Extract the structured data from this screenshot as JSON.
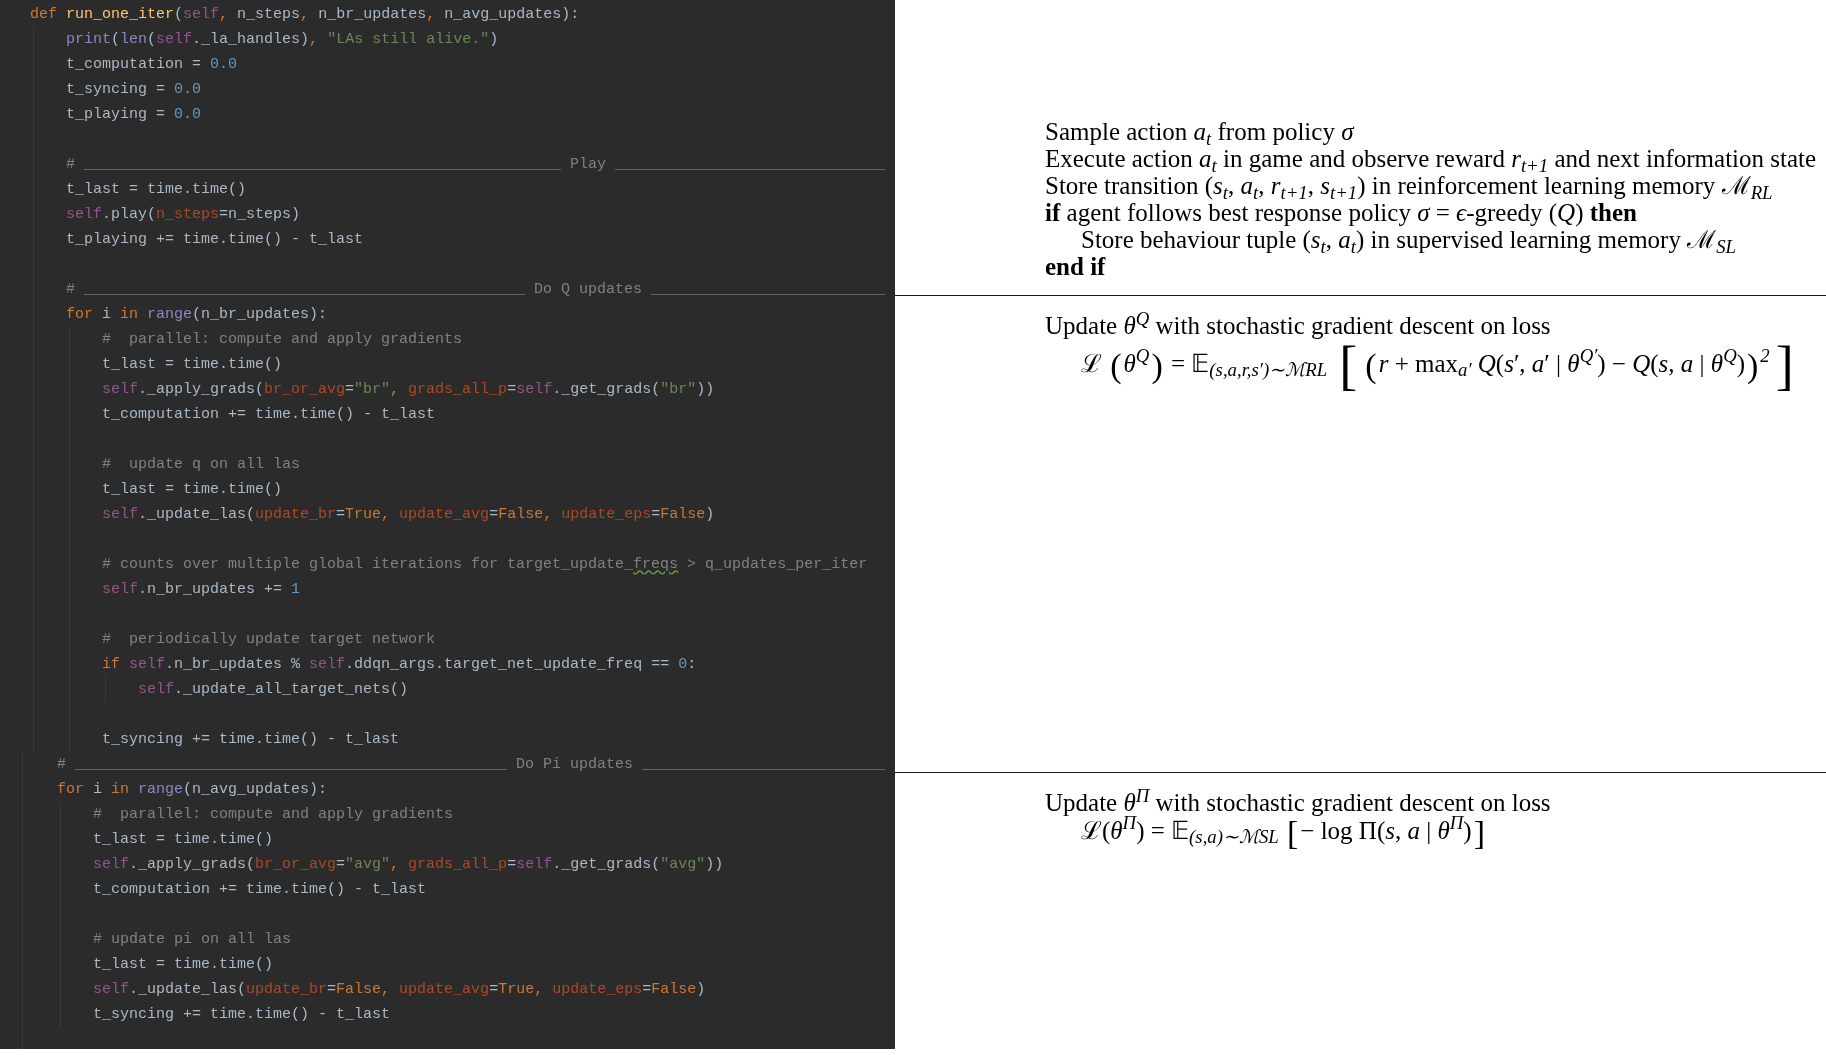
{
  "code_editor": {
    "snippets": [
      {
        "lines": [
          {
            "kind": "code",
            "tokens": [
              {
                "kind": "kw",
                "text": "def "
              },
              {
                "kind": "fn",
                "text": "run_one_iter"
              },
              {
                "kind": "txt",
                "text": "("
              },
              {
                "kind": "self",
                "text": "self"
              },
              {
                "kind": "pun",
                "text": ", "
              },
              {
                "kind": "txt",
                "text": "n_steps"
              },
              {
                "kind": "pun",
                "text": ", "
              },
              {
                "kind": "txt",
                "text": "n_br_updates"
              },
              {
                "kind": "pun",
                "text": ", "
              },
              {
                "kind": "txt",
                "text": "n_avg_updates):"
              }
            ],
            "children": [
              {
                "kind": "code",
                "tokens": [
                  {
                    "kind": "bi",
                    "text": "print"
                  },
                  {
                    "kind": "txt",
                    "text": "("
                  },
                  {
                    "kind": "bi",
                    "text": "len"
                  },
                  {
                    "kind": "txt",
                    "text": "("
                  },
                  {
                    "kind": "self",
                    "text": "self"
                  },
                  {
                    "kind": "txt",
                    "text": "._la_handles)"
                  },
                  {
                    "kind": "pun",
                    "text": ", "
                  },
                  {
                    "kind": "str",
                    "text": "\"LAs still alive.\""
                  },
                  {
                    "kind": "txt",
                    "text": ")"
                  }
                ]
              },
              {
                "kind": "code",
                "tokens": [
                  {
                    "kind": "txt",
                    "text": "t_computation = "
                  },
                  {
                    "kind": "num",
                    "text": "0.0"
                  }
                ]
              },
              {
                "kind": "code",
                "tokens": [
                  {
                    "kind": "txt",
                    "text": "t_syncing = "
                  },
                  {
                    "kind": "num",
                    "text": "0.0"
                  }
                ]
              },
              {
                "kind": "code",
                "tokens": [
                  {
                    "kind": "txt",
                    "text": "t_playing = "
                  },
                  {
                    "kind": "num",
                    "text": "0.0"
                  }
                ]
              },
              {
                "kind": "blank"
              },
              {
                "kind": "code",
                "tokens": [
                  {
                    "kind": "cmt",
                    "text": "# _____________________________________________________ Play ______________________________"
                  }
                ]
              },
              {
                "kind": "code",
                "tokens": [
                  {
                    "kind": "txt",
                    "text": "t_last = time.time()"
                  }
                ]
              },
              {
                "kind": "code",
                "tokens": [
                  {
                    "kind": "self",
                    "text": "self"
                  },
                  {
                    "kind": "txt",
                    "text": ".play("
                  },
                  {
                    "kind": "arg",
                    "text": "n_steps"
                  },
                  {
                    "kind": "txt",
                    "text": "=n_steps)"
                  }
                ]
              },
              {
                "kind": "code",
                "tokens": [
                  {
                    "kind": "txt",
                    "text": "t_playing += time.time() - t_last"
                  }
                ]
              },
              {
                "kind": "blank"
              },
              {
                "kind": "code",
                "tokens": [
                  {
                    "kind": "cmt",
                    "text": "# _________________________________________________ Do Q updates __________________________"
                  }
                ]
              },
              {
                "kind": "code",
                "tokens": [
                  {
                    "kind": "kw",
                    "text": "for "
                  },
                  {
                    "kind": "txt",
                    "text": "i "
                  },
                  {
                    "kind": "kw",
                    "text": "in "
                  },
                  {
                    "kind": "bi",
                    "text": "range"
                  },
                  {
                    "kind": "txt",
                    "text": "(n_br_updates):"
                  }
                ],
                "children": [
                  {
                    "kind": "code",
                    "tokens": [
                      {
                        "kind": "cmt",
                        "text": "#  parallel: compute and apply gradients"
                      }
                    ]
                  },
                  {
                    "kind": "code",
                    "tokens": [
                      {
                        "kind": "txt",
                        "text": "t_last = time.time()"
                      }
                    ]
                  },
                  {
                    "kind": "code",
                    "tokens": [
                      {
                        "kind": "self",
                        "text": "self"
                      },
                      {
                        "kind": "txt",
                        "text": "._apply_grads("
                      },
                      {
                        "kind": "arg",
                        "text": "br_or_avg"
                      },
                      {
                        "kind": "txt",
                        "text": "="
                      },
                      {
                        "kind": "str",
                        "text": "\"br\""
                      },
                      {
                        "kind": "pun",
                        "text": ", "
                      },
                      {
                        "kind": "arg",
                        "text": "grads_all_p"
                      },
                      {
                        "kind": "txt",
                        "text": "="
                      },
                      {
                        "kind": "self",
                        "text": "self"
                      },
                      {
                        "kind": "txt",
                        "text": "._get_grads("
                      },
                      {
                        "kind": "str",
                        "text": "\"br\""
                      },
                      {
                        "kind": "txt",
                        "text": "))"
                      }
                    ]
                  },
                  {
                    "kind": "code",
                    "tokens": [
                      {
                        "kind": "txt",
                        "text": "t_computation += time.time() - t_last"
                      }
                    ]
                  },
                  {
                    "kind": "blank"
                  },
                  {
                    "kind": "code",
                    "tokens": [
                      {
                        "kind": "cmt",
                        "text": "#  update q on all las"
                      }
                    ]
                  },
                  {
                    "kind": "code",
                    "tokens": [
                      {
                        "kind": "txt",
                        "text": "t_last = time.time()"
                      }
                    ]
                  },
                  {
                    "kind": "code",
                    "tokens": [
                      {
                        "kind": "self",
                        "text": "self"
                      },
                      {
                        "kind": "txt",
                        "text": "._update_las("
                      },
                      {
                        "kind": "arg",
                        "text": "update_br"
                      },
                      {
                        "kind": "txt",
                        "text": "="
                      },
                      {
                        "kind": "kw",
                        "text": "True"
                      },
                      {
                        "kind": "pun",
                        "text": ", "
                      },
                      {
                        "kind": "arg",
                        "text": "update_avg"
                      },
                      {
                        "kind": "txt",
                        "text": "="
                      },
                      {
                        "kind": "kw",
                        "text": "False"
                      },
                      {
                        "kind": "pun",
                        "text": ", "
                      },
                      {
                        "kind": "arg",
                        "text": "update_eps"
                      },
                      {
                        "kind": "txt",
                        "text": "="
                      },
                      {
                        "kind": "kw",
                        "text": "False"
                      },
                      {
                        "kind": "txt",
                        "text": ")"
                      }
                    ]
                  },
                  {
                    "kind": "blank"
                  },
                  {
                    "kind": "code",
                    "tokens": [
                      {
                        "kind": "cmt",
                        "text": "# counts over multiple global iterations for target_update_"
                      },
                      {
                        "kind": "typo",
                        "text": "freqs"
                      },
                      {
                        "kind": "cmt",
                        "text": " > q_updates_per_iter"
                      }
                    ]
                  },
                  {
                    "kind": "code",
                    "tokens": [
                      {
                        "kind": "self",
                        "text": "self"
                      },
                      {
                        "kind": "txt",
                        "text": ".n_br_updates += "
                      },
                      {
                        "kind": "num",
                        "text": "1"
                      }
                    ]
                  },
                  {
                    "kind": "blank"
                  },
                  {
                    "kind": "code",
                    "tokens": [
                      {
                        "kind": "cmt",
                        "text": "#  periodically update target network"
                      }
                    ]
                  },
                  {
                    "kind": "code",
                    "tokens": [
                      {
                        "kind": "kw",
                        "text": "if "
                      },
                      {
                        "kind": "self",
                        "text": "self"
                      },
                      {
                        "kind": "txt",
                        "text": ".n_br_updates % "
                      },
                      {
                        "kind": "self",
                        "text": "self"
                      },
                      {
                        "kind": "txt",
                        "text": ".ddqn_args.target_net_update_freq == "
                      },
                      {
                        "kind": "num",
                        "text": "0"
                      },
                      {
                        "kind": "txt",
                        "text": ":"
                      }
                    ],
                    "children": [
                      {
                        "kind": "code",
                        "tokens": [
                          {
                            "kind": "self",
                            "text": "self"
                          },
                          {
                            "kind": "txt",
                            "text": "._update_all_target_nets()"
                          }
                        ]
                      }
                    ]
                  },
                  {
                    "kind": "blank"
                  },
                  {
                    "kind": "code",
                    "tokens": [
                      {
                        "kind": "txt",
                        "text": "t_syncing += time.time() - t_last"
                      }
                    ]
                  }
                ]
              }
            ]
          }
        ]
      },
      {
        "lines": [
          {
            "kind": "code",
            "tokens": [
              {
                "kind": "cmt",
                "text": "# ________________________________________________ Do Pi updates ___________________________"
              }
            ]
          },
          {
            "kind": "code",
            "tokens": [
              {
                "kind": "kw",
                "text": "for "
              },
              {
                "kind": "txt",
                "text": "i "
              },
              {
                "kind": "kw",
                "text": "in "
              },
              {
                "kind": "bi",
                "text": "range"
              },
              {
                "kind": "txt",
                "text": "(n_avg_updates):"
              }
            ],
            "children": [
              {
                "kind": "code",
                "tokens": [
                  {
                    "kind": "cmt",
                    "text": "#  parallel: compute and apply gradients"
                  }
                ]
              },
              {
                "kind": "code",
                "tokens": [
                  {
                    "kind": "txt",
                    "text": "t_last = time.time()"
                  }
                ]
              },
              {
                "kind": "code",
                "tokens": [
                  {
                    "kind": "self",
                    "text": "self"
                  },
                  {
                    "kind": "txt",
                    "text": "._apply_grads("
                  },
                  {
                    "kind": "arg",
                    "text": "br_or_avg"
                  },
                  {
                    "kind": "txt",
                    "text": "="
                  },
                  {
                    "kind": "str",
                    "text": "\"avg\""
                  },
                  {
                    "kind": "pun",
                    "text": ", "
                  },
                  {
                    "kind": "arg",
                    "text": "grads_all_p"
                  },
                  {
                    "kind": "txt",
                    "text": "="
                  },
                  {
                    "kind": "self",
                    "text": "self"
                  },
                  {
                    "kind": "txt",
                    "text": "._get_grads("
                  },
                  {
                    "kind": "str",
                    "text": "\"avg\""
                  },
                  {
                    "kind": "txt",
                    "text": "))"
                  }
                ]
              },
              {
                "kind": "code",
                "tokens": [
                  {
                    "kind": "txt",
                    "text": "t_computation += time.time() - t_last"
                  }
                ]
              },
              {
                "kind": "blank"
              },
              {
                "kind": "code",
                "tokens": [
                  {
                    "kind": "cmt",
                    "text": "# update pi on all las"
                  }
                ]
              },
              {
                "kind": "code",
                "tokens": [
                  {
                    "kind": "txt",
                    "text": "t_last = time.time()"
                  }
                ]
              },
              {
                "kind": "code",
                "tokens": [
                  {
                    "kind": "self",
                    "text": "self"
                  },
                  {
                    "kind": "txt",
                    "text": "._update_las("
                  },
                  {
                    "kind": "arg",
                    "text": "update_br"
                  },
                  {
                    "kind": "txt",
                    "text": "="
                  },
                  {
                    "kind": "kw",
                    "text": "False"
                  },
                  {
                    "kind": "pun",
                    "text": ", "
                  },
                  {
                    "kind": "arg",
                    "text": "update_avg"
                  },
                  {
                    "kind": "txt",
                    "text": "="
                  },
                  {
                    "kind": "kw",
                    "text": "True"
                  },
                  {
                    "kind": "pun",
                    "text": ", "
                  },
                  {
                    "kind": "arg",
                    "text": "update_eps"
                  },
                  {
                    "kind": "txt",
                    "text": "="
                  },
                  {
                    "kind": "kw",
                    "text": "False"
                  },
                  {
                    "kind": "txt",
                    "text": ")"
                  }
                ]
              },
              {
                "kind": "code",
                "tokens": [
                  {
                    "kind": "txt",
                    "text": "t_syncing += time.time() - t_last"
                  }
                ]
              }
            ]
          }
        ]
      }
    ]
  },
  "algorithm": {
    "sections": [
      {
        "lines": [
          {
            "kind": "statement",
            "text": "Sample action *a*$_{t}$ from policy *σ*"
          },
          {
            "kind": "statement",
            "text": "Execute action *a*$_{t}$ in game and observe reward *r*$_{t+1}$ and next information state"
          },
          {
            "kind": "statement",
            "text": "Store transition (*s*$_{t}$, *a*$_{t}$, *r*$_{t+1}$, *s*$_{t+1}$) in reinforcement learning memory ℳ$_{RL}$"
          },
          {
            "kind": "statement",
            "text": "**if** agent follows best response policy *σ* = *ϵ*-greedy (*Q*) **then**",
            "children": [
              {
                "kind": "statement",
                "text": "Store behaviour tuple (*s*$_{t}$, *a*$_{t}$) in supervised learning memory ℳ$_{SL}$"
              }
            ]
          },
          {
            "kind": "end",
            "text": "end if"
          }
        ]
      },
      {
        "lines": [
          {
            "kind": "statement",
            "text": "Update *θ*$^{Q}$ with stochastic gradient descent on loss",
            "children": [
              {
                "kind": "formula",
                "parts": [
                  {
                    "kind": "text",
                    "text": "ℒ "
                  },
                  {
                    "kind": "delim",
                    "text": "("
                  },
                  {
                    "kind": "text",
                    "text": "*θ*$^{Q}$"
                  },
                  {
                    "kind": "delim",
                    "text": ")"
                  },
                  {
                    "kind": "text",
                    "text": " = 𝔼$_{(s,a,r,s′)∼ℳRL}$ "
                  },
                  {
                    "kind": "big_delim",
                    "text": "["
                  },
                  {
                    "kind": "delim",
                    "text": "("
                  },
                  {
                    "kind": "text",
                    "text": "*r* + max$_{a′}$ *Q*(*s*′, *a*′ | *θ*$^{Q′}$) − *Q*(*s*, *a* | *θ*$^{Q}$)"
                  },
                  {
                    "kind": "delim",
                    "text": ")"
                  },
                  {
                    "kind": "text",
                    "text": "$^{2}$"
                  },
                  {
                    "kind": "big_delim",
                    "text": "]"
                  }
                ]
              }
            ]
          }
        ]
      },
      {
        "lines": [
          {
            "kind": "statement",
            "text": "Update *θ*$^{Π}$ with stochastic gradient descent on loss",
            "children": [
              {
                "kind": "formula",
                "parts": [
                  {
                    "kind": "text",
                    "text": "ℒ(*θ*$^{Π}$) = 𝔼$_{(s,a)∼ℳSL}$ "
                  },
                  {
                    "kind": "delim",
                    "text": "["
                  },
                  {
                    "kind": "text",
                    "text": "− log Π(*s*, *a* | *θ*$^{Π}$)"
                  },
                  {
                    "kind": "delim",
                    "text": "]"
                  }
                ]
              }
            ]
          }
        ]
      }
    ]
  }
}
